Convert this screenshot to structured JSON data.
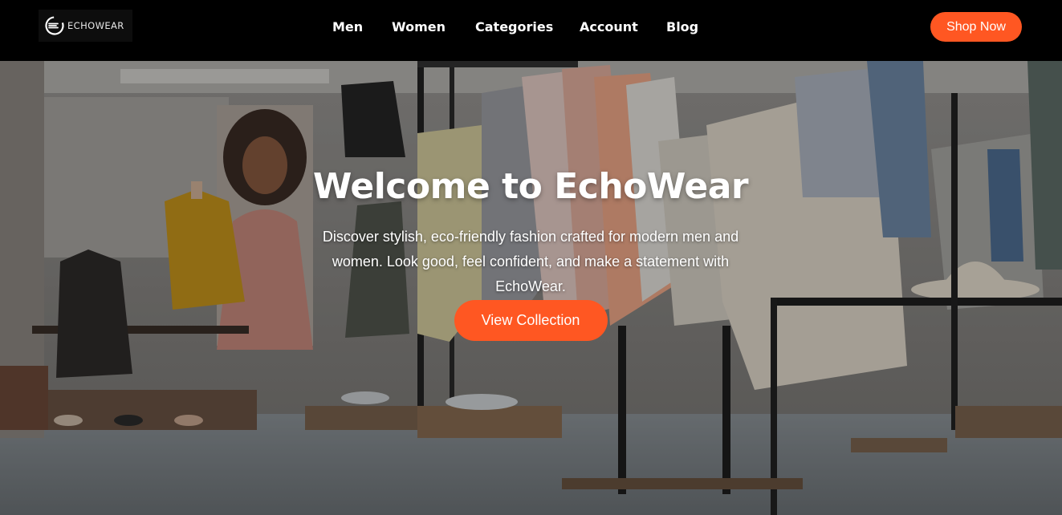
{
  "brand": {
    "name": "ECHOWEAR",
    "logo_icon": "echowear-logo-icon"
  },
  "nav": {
    "items": [
      {
        "label": "Men"
      },
      {
        "label": "Women"
      },
      {
        "label": "Categories"
      },
      {
        "label": "Account"
      },
      {
        "label": "Blog"
      }
    ],
    "cta_label": "Shop Now"
  },
  "hero": {
    "title": "Welcome to EchoWear",
    "description": "Discover stylish, eco-friendly fashion crafted for modern men and women. Look good, feel confident, and make a statement with EchoWear.",
    "cta_label": "View Collection",
    "background_image": "clothing-store-interior-photo"
  },
  "colors": {
    "accent": "#ff5722",
    "nav_background": "#000000",
    "text": "#ffffff"
  }
}
